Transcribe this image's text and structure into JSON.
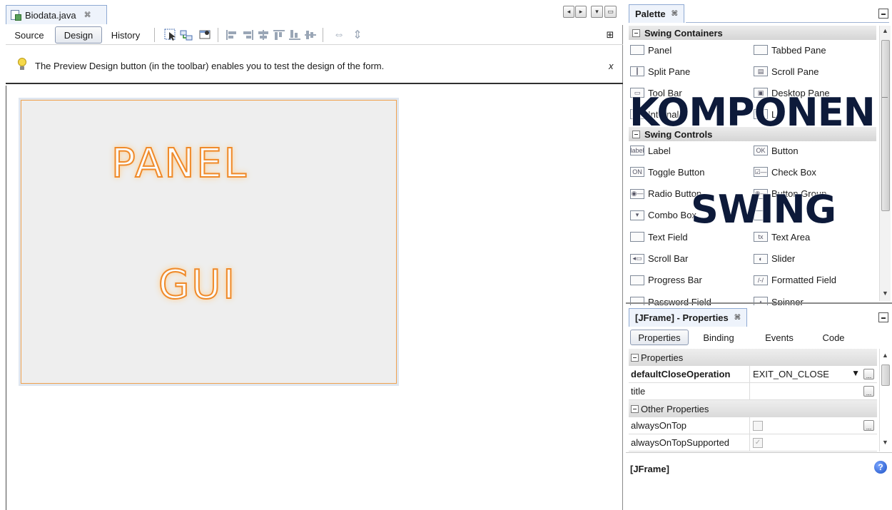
{
  "editor": {
    "file_tab": "Biodata.java",
    "tab_close_glyph": "⌘",
    "view_buttons": {
      "source": "Source",
      "design": "Design",
      "history": "History"
    },
    "hint": "The Preview Design button (in the toolbar) enables you to test the design of the form.",
    "hint_close": "x",
    "design_text": {
      "line1": "PANEL",
      "line2": "GUI"
    },
    "accent_color": "#ef8a2a"
  },
  "palette": {
    "title": "Palette",
    "categories": {
      "containers": {
        "label": "Swing Containers",
        "items": [
          {
            "label": "Panel",
            "icon": "panel-icon",
            "glyph": ""
          },
          {
            "label": "Tabbed Pane",
            "icon": "tabbed-pane-icon",
            "glyph": ""
          },
          {
            "label": "Split Pane",
            "icon": "split-pane-icon",
            "glyph": "┃"
          },
          {
            "label": "Scroll Pane",
            "icon": "scroll-pane-icon",
            "glyph": "▤"
          },
          {
            "label": "Tool Bar",
            "icon": "toolbar-icon",
            "glyph": "▭"
          },
          {
            "label": "Desktop Pane",
            "icon": "desktop-pane-icon",
            "glyph": "▣"
          },
          {
            "label": "Internal F",
            "icon": "internal-frame-icon",
            "glyph": "▭"
          },
          {
            "label": "La",
            "icon": "layered-pane-icon",
            "glyph": "▦"
          }
        ]
      },
      "controls": {
        "label": "Swing Controls",
        "items": [
          {
            "label": "Label",
            "icon": "label-icon",
            "glyph": "label"
          },
          {
            "label": "Button",
            "icon": "button-icon",
            "glyph": "OK"
          },
          {
            "label": "Toggle Button",
            "icon": "toggle-button-icon",
            "glyph": "ON"
          },
          {
            "label": "Check Box",
            "icon": "checkbox-icon",
            "glyph": "☑—"
          },
          {
            "label": "Radio Button",
            "icon": "radio-button-icon",
            "glyph": "◉—"
          },
          {
            "label": "Button Group",
            "icon": "button-group-icon",
            "glyph": "◉—"
          },
          {
            "label": "Combo Box",
            "icon": "combo-box-icon",
            "glyph": "▾"
          },
          {
            "label": "",
            "icon": "list-icon",
            "glyph": ""
          },
          {
            "label": "Text Field",
            "icon": "text-field-icon",
            "glyph": ""
          },
          {
            "label": "Text Area",
            "icon": "text-area-icon",
            "glyph": "tx"
          },
          {
            "label": "Scroll Bar",
            "icon": "scroll-bar-icon",
            "glyph": "◂▭"
          },
          {
            "label": "Slider",
            "icon": "slider-icon",
            "glyph": "◐"
          },
          {
            "label": "Progress Bar",
            "icon": "progress-bar-icon",
            "glyph": ""
          },
          {
            "label": "Formatted Field",
            "icon": "formatted-field-icon",
            "glyph": "/-/"
          },
          {
            "label": "Password Field",
            "icon": "password-field-icon",
            "glyph": ""
          },
          {
            "label": "Spinner",
            "icon": "spinner-icon",
            "glyph": "▴"
          }
        ]
      }
    },
    "overlay": {
      "line1": "KOMPONEN",
      "line2": "SWING"
    }
  },
  "properties": {
    "title": "[JFrame] - Properties",
    "tabs": [
      "Properties",
      "Binding",
      "Events",
      "Code"
    ],
    "section_main": "Properties",
    "section_other": "Other Properties",
    "rows": [
      {
        "name": "defaultCloseOperation",
        "value": "EXIT_ON_CLOSE",
        "bold": true
      },
      {
        "name": "title",
        "value": ""
      }
    ],
    "other_rows": [
      {
        "name": "alwaysOnTop",
        "checked": false
      },
      {
        "name": "alwaysOnTopSupported",
        "checked": true
      }
    ],
    "footer": "[JFrame]"
  }
}
